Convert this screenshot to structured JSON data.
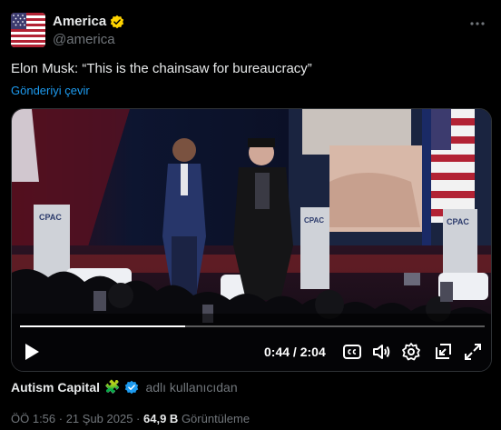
{
  "author": {
    "display_name": "America",
    "handle": "@america",
    "verified": "gold"
  },
  "tweet": {
    "text": "Elon Musk: “This is the chainsaw for bureaucracy”",
    "translate_label": "Gönderiyi çevir"
  },
  "video": {
    "current_time": "0:44",
    "duration": "2:04",
    "time_separator": " / ",
    "progress_fraction": 0.355,
    "stage_sign_left": "CPAC",
    "stage_sign_mid": "CPAC",
    "stage_sign_right": "CPAC",
    "controls": [
      "play-icon",
      "captions-icon",
      "volume-icon",
      "settings-icon",
      "picture-in-picture-icon",
      "fullscreen-icon"
    ]
  },
  "source": {
    "name": "Autism Capital",
    "emoji": "🧩",
    "suffix": "adlı kullanıcıdan"
  },
  "meta": {
    "time": "ÖÖ 1:56",
    "separator": " · ",
    "date": "21 Şub 2025",
    "views_count": "64,9 B",
    "views_label": "Görüntüleme"
  },
  "colors": {
    "accent": "#1d9bf0",
    "verified_gold": "#ffd400",
    "text_secondary": "#71767b"
  }
}
